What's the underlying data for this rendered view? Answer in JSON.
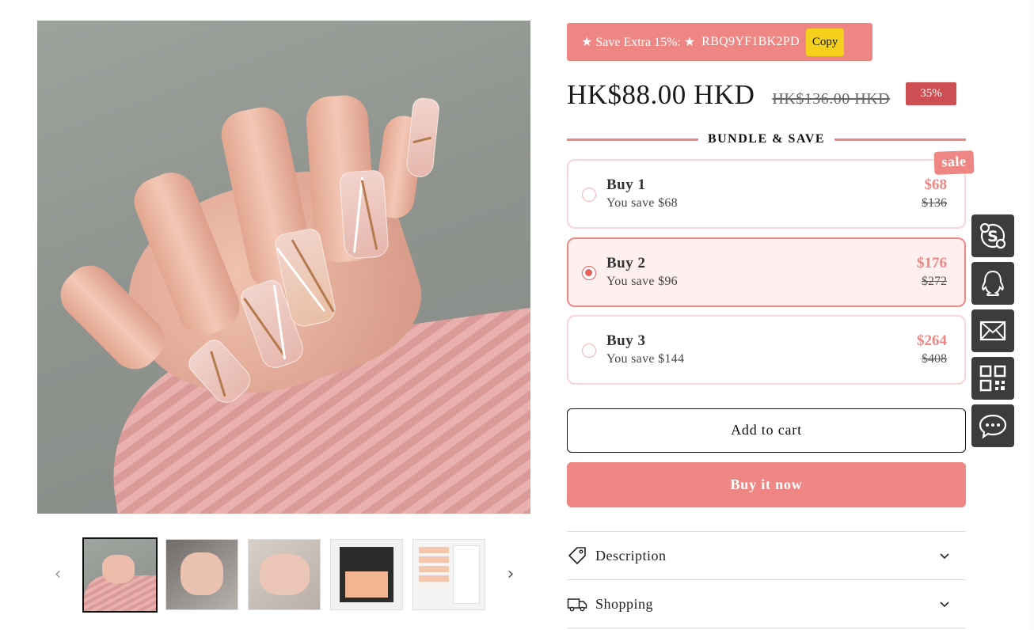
{
  "coupon": {
    "label": "★ Save Extra 15%: ★",
    "code": "RBQ9YF1BK2PD",
    "copy_label": "Copy"
  },
  "pricing": {
    "price": "HK$88.00 HKD",
    "compare_price": "HK$136.00 HKD",
    "discount_badge": "35%"
  },
  "bundle": {
    "title": "BUNDLE & SAVE",
    "sale_tag": "sale",
    "options": [
      {
        "title": "Buy 1",
        "save": "You save $68",
        "price": "$68",
        "compare": "$136",
        "selected": false
      },
      {
        "title": "Buy 2",
        "save": "You save $96",
        "price": "$176",
        "compare": "$272",
        "selected": true
      },
      {
        "title": "Buy 3",
        "save": "You save $144",
        "price": "$264",
        "compare": "$408",
        "selected": false
      }
    ]
  },
  "actions": {
    "add_to_cart": "Add to cart",
    "buy_now": "Buy it now"
  },
  "accordion": [
    {
      "label": "Description",
      "icon": "tag-icon"
    },
    {
      "label": "Shopping",
      "icon": "truck-icon"
    }
  ],
  "gallery": {
    "thumbnail_count": 5,
    "active_index": 0
  },
  "contact_bar": [
    "skype-icon",
    "qq-icon",
    "mail-icon",
    "qr-code-icon",
    "chat-icon"
  ],
  "colors": {
    "accent": "#ee8783",
    "badge": "#cc4f54",
    "copy_button": "#f5d11d",
    "contact_bg": "#3c3c3c"
  }
}
